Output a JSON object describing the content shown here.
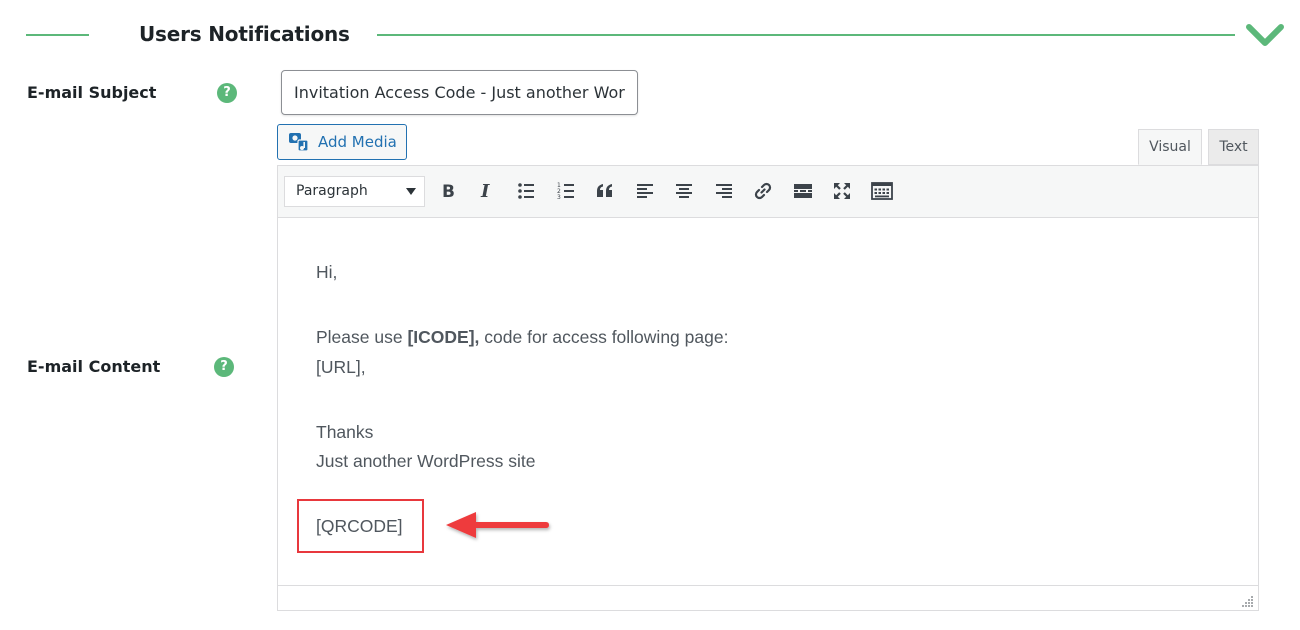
{
  "section": {
    "title": "Users Notifications"
  },
  "subject": {
    "label": "E-mail Subject",
    "value": "Invitation Access Code - Just another Word"
  },
  "content_field": {
    "label": "E-mail Content"
  },
  "help_icon_text": "?",
  "editor": {
    "add_media_label": "Add Media",
    "tabs": [
      {
        "label": "Visual"
      },
      {
        "label": "Text"
      }
    ],
    "format_select_value": "Paragraph",
    "body": {
      "greeting": "Hi,",
      "line1_pre": "Please use ",
      "line1_code": "[ICODE],",
      "line1_post": " code for access following page:",
      "url": "[URL],",
      "thanks": "Thanks",
      "site": "Just another WordPress site",
      "qrcode": "[QRCODE]"
    }
  },
  "colors": {
    "accent_green": "#5cb87a",
    "link_blue": "#2271b1",
    "highlight_red": "#e8383d"
  },
  "toolbar_icons": [
    "bold-icon",
    "italic-icon",
    "bullet-list-icon",
    "numbered-list-icon",
    "blockquote-icon",
    "align-left-icon",
    "align-center-icon",
    "align-right-icon",
    "link-icon",
    "read-more-icon",
    "fullscreen-icon",
    "toolbar-toggle-icon"
  ]
}
